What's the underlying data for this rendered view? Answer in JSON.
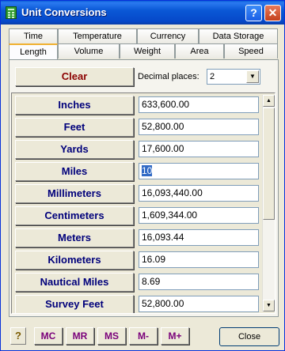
{
  "window": {
    "title": "Unit Conversions",
    "help_glyph": "?",
    "close_glyph": "✕"
  },
  "tabs_top": [
    "Time",
    "Temperature",
    "Currency",
    "Data Storage"
  ],
  "tabs_bottom": [
    "Length",
    "Volume",
    "Weight",
    "Area",
    "Speed"
  ],
  "active_tab": "Length",
  "clear_label": "Clear",
  "decimal": {
    "label": "Decimal places:",
    "value": "2"
  },
  "units": [
    {
      "label": "Inches",
      "value": "633,600.00"
    },
    {
      "label": "Feet",
      "value": "52,800.00"
    },
    {
      "label": "Yards",
      "value": "17,600.00"
    },
    {
      "label": "Miles",
      "value": "10",
      "selected": true
    },
    {
      "label": "Millimeters",
      "value": "16,093,440.00"
    },
    {
      "label": "Centimeters",
      "value": "1,609,344.00"
    },
    {
      "label": "Meters",
      "value": "16,093.44"
    },
    {
      "label": "Kilometers",
      "value": "16.09"
    },
    {
      "label": "Nautical Miles",
      "value": "8.69"
    },
    {
      "label": "Survey Feet",
      "value": "52,800.00"
    }
  ],
  "memory_buttons": [
    "MC",
    "MR",
    "MS",
    "M-",
    "M+"
  ],
  "bottom_help_glyph": "?",
  "close_label": "Close",
  "colors": {
    "title_bar": "#0a58d6",
    "unit_label": "#00007b",
    "clear_label": "#8b0000",
    "memory_label": "#7a007a",
    "selection": "#316ac5"
  }
}
